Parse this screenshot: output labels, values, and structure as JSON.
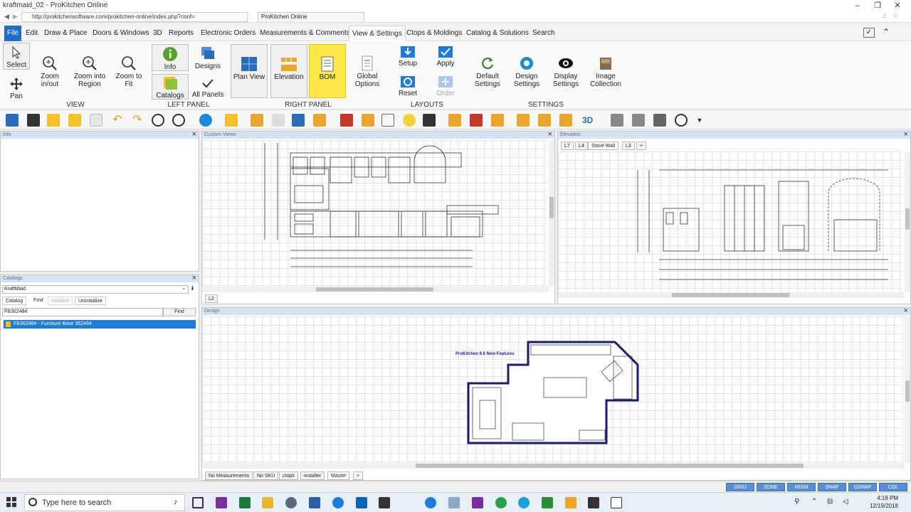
{
  "window": {
    "title": "kraftmaid_02 - ProKitchen Online",
    "minimize": "–",
    "maximize": "❐",
    "close": "✕"
  },
  "browser": {
    "url": "http://prokitchensoftware.com/prokitchen-online/index.php?conf=",
    "tab_title": "ProKitchen Online"
  },
  "menu": {
    "items": [
      "File",
      "Edit",
      "Draw & Place",
      "Doors & Windows",
      "3D",
      "Reports",
      "Electronic Orders",
      "Measurements & Comments",
      "View & Settings",
      "Ctops & Moldings",
      "Catalog & Solutions",
      "Search"
    ]
  },
  "ribbon": {
    "view": {
      "label": "VIEW",
      "select": "Select",
      "pan": "Pan",
      "zoom_inout": "Zoom in/out",
      "zoom_region": "Zoom into Region",
      "zoom_fit": "Zoom to Fit"
    },
    "left_panel": {
      "label": "LEFT PANEL",
      "info": "Info",
      "designs": "Designs",
      "catalogs": "Catalogs",
      "all_panels": "All Panels"
    },
    "right_panel": {
      "label": "RIGHT PANEL",
      "plan_view": "Plan View",
      "elevation": "Elevation",
      "bom": "BOM"
    },
    "global_options": "Global Options",
    "layouts": {
      "label": "LAYOUTS",
      "setup": "Setup",
      "apply": "Apply",
      "reset": "Reset",
      "order": "Order"
    },
    "settings": {
      "label": "SETTINGS",
      "default": "Default Settings",
      "design": "Design Settings",
      "display": "Display Settings",
      "image": "Image Collection"
    }
  },
  "toolbar": {
    "three_d": "3D"
  },
  "panels": {
    "info": {
      "title": "Info"
    },
    "catalogs": {
      "title": "Catalogs",
      "catalog_select": "KraftMaid",
      "tabs": [
        "Catalog",
        "Find",
        "Initialize",
        "Uninitialize"
      ],
      "search_value": "FB362484",
      "find_button": "Find",
      "result": "FB362484 - Furniture Base 362484"
    },
    "custom_views": {
      "title": "Custom Views",
      "tab": "L2"
    },
    "elevation": {
      "title": "Elevation",
      "tabs": [
        "L7",
        "L4",
        "Stove Wall",
        "L3",
        "+"
      ]
    },
    "design": {
      "title": "Design",
      "note": "ProKitchen 9.6 New Features",
      "tabs": [
        "No Measurements",
        "No SKU",
        "ctops",
        "installer",
        "Master",
        "+"
      ]
    }
  },
  "statusbar": {
    "buttons": [
      "GRID",
      "ZONE",
      "MDIM",
      "SNAP",
      "GSNAP",
      "COL"
    ],
    "color": "#5b8ed1"
  },
  "taskbar": {
    "search_placeholder": "Type here to search",
    "time": "4:18 PM",
    "date": "12/19/2018"
  },
  "colors": {
    "accent": "#1e6fc9",
    "selection": "#1e7bd8",
    "bom_highlight": "#ffe84c",
    "plan_wall": "#1a1a6e"
  }
}
